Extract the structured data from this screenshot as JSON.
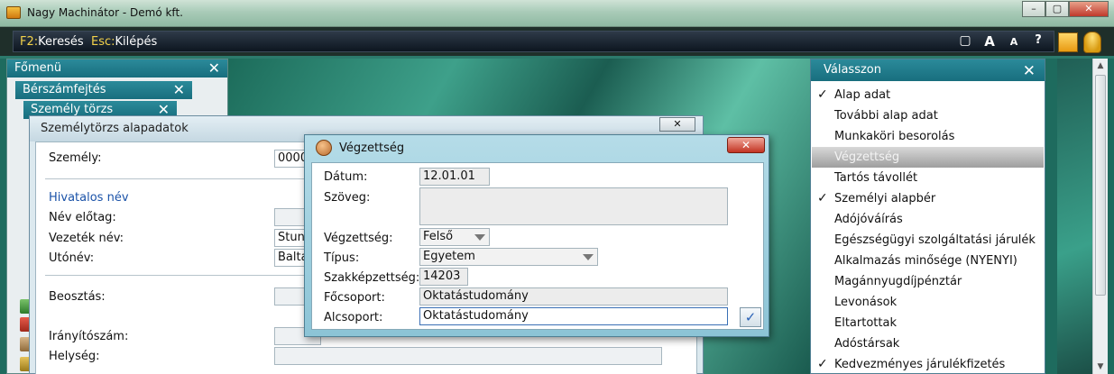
{
  "window": {
    "title": "Nagy Machinátor - Demó kft.",
    "min": "–",
    "max": "▢",
    "close": "✕"
  },
  "toolbar": {
    "search_key": "F2:",
    "search_label": "Keresés",
    "exit_key": "Esc:",
    "exit_label": "Kilépés",
    "icons": {
      "window": "▢",
      "font_large": "A",
      "font_small": "A",
      "help": "?"
    }
  },
  "panels": {
    "main_menu": "Főmenü",
    "payroll": "Bérszámfejtés",
    "person_master": "Személy törzs",
    "close": "✕"
  },
  "form": {
    "title": "Személytörzs alapadatok",
    "close": "✕",
    "person_label": "Személy:",
    "person_value": "0000",
    "official_name_section": "Hivatalos név",
    "prefix_label": "Név előtag:",
    "prefix_value": "",
    "surname_label": "Vezeték név:",
    "surname_value": "Stun",
    "given_label": "Utónév:",
    "given_value": "Balta",
    "position_label": "Beosztás:",
    "position_value": "",
    "zip_label": "Irányítószám:",
    "zip_value": "",
    "city_label": "Helység:",
    "city_value": ""
  },
  "dialog": {
    "title": "Végzettség",
    "close": "✕",
    "date_label": "Dátum:",
    "date_value": "12.01.01",
    "text_label": "Szöveg:",
    "text_value": "",
    "education_label": "Végzettség:",
    "education_value": "Felső",
    "type_label": "Típus:",
    "type_value": "Egyetem",
    "qualification_label": "Szakképzettség:",
    "qualification_value": "14203",
    "main_group_label": "Főcsoport:",
    "main_group_value": "Oktatástudomány",
    "sub_group_label": "Alcsoport:",
    "sub_group_value": "Oktatástudomány",
    "ok": "✓"
  },
  "chooser": {
    "title": "Válasszon",
    "close": "✕",
    "items": [
      {
        "label": "Alap adat",
        "checked": "✓"
      },
      {
        "label": "További alap adat",
        "checked": ""
      },
      {
        "label": "Munkaköri besorolás",
        "checked": ""
      },
      {
        "label": "Végzettség",
        "checked": ""
      },
      {
        "label": "Tartós távollét",
        "checked": ""
      },
      {
        "label": "Személyi alapbér",
        "checked": "✓"
      },
      {
        "label": "Adójóváírás",
        "checked": ""
      },
      {
        "label": "Egészségügyi szolgáltatási járulék",
        "checked": ""
      },
      {
        "label": "Alkalmazás minősége (NYENYI)",
        "checked": ""
      },
      {
        "label": "Magánnyugdíjpénztár",
        "checked": ""
      },
      {
        "label": "Levonások",
        "checked": ""
      },
      {
        "label": "Eltartottak",
        "checked": ""
      },
      {
        "label": "Adóstársak",
        "checked": ""
      },
      {
        "label": "Kedvezményes járulékfizetés",
        "checked": "✓"
      }
    ],
    "selected_index": 3
  },
  "scrollbar": {
    "up": "▲",
    "down": "▼"
  }
}
